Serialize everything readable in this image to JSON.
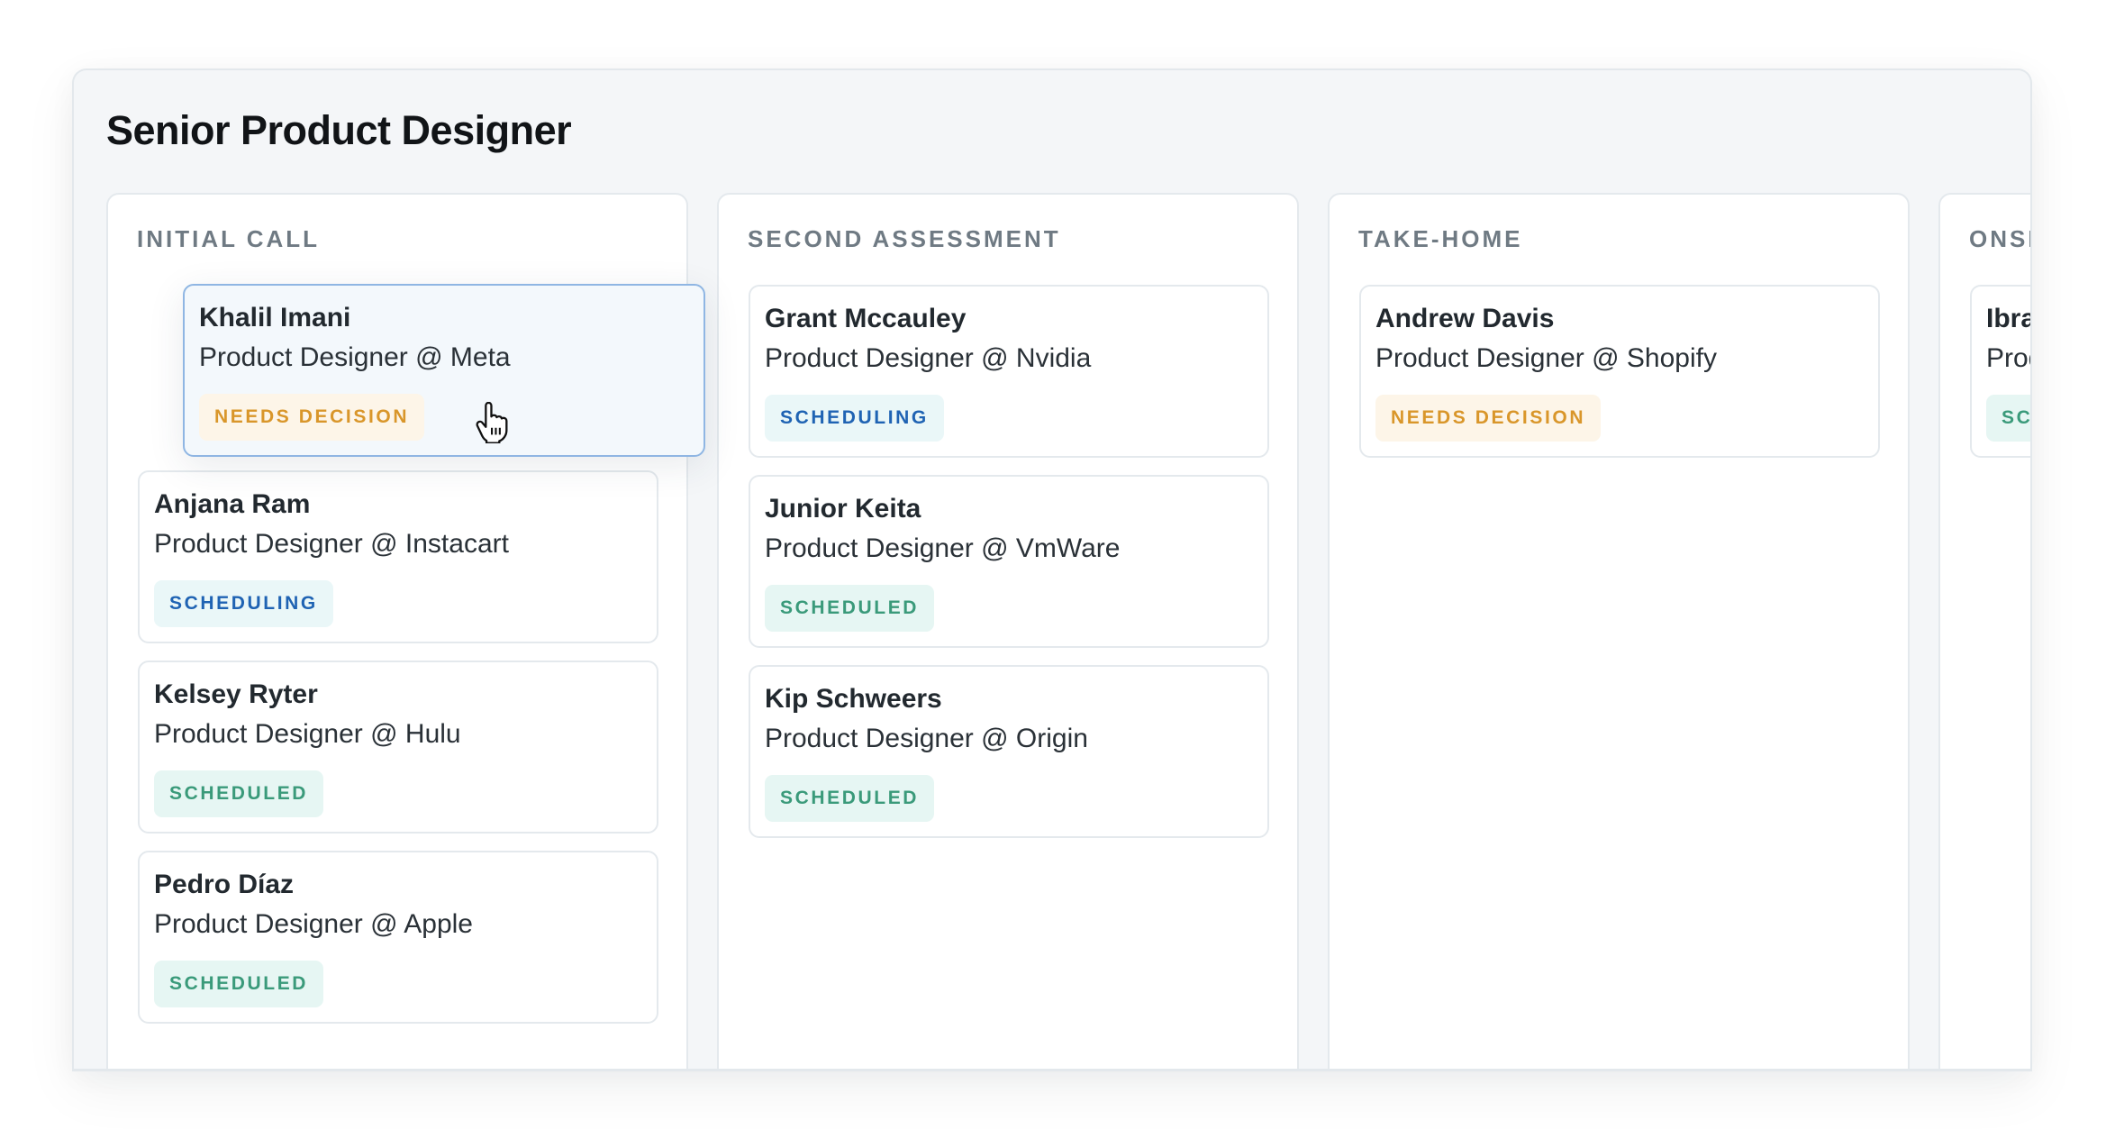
{
  "page": {
    "title": "Senior Product Designer"
  },
  "status_colors": {
    "needs_decision": {
      "bg": "#fdf5e8",
      "fg": "#d9962a"
    },
    "scheduling": {
      "bg": "#eaf7f8",
      "fg": "#1f63b3"
    },
    "scheduled": {
      "bg": "#e6f6f3",
      "fg": "#3a9a7a"
    }
  },
  "dragging_card": {
    "name": "Khalil Imani",
    "role": "Product Designer @ Meta",
    "status": "NEEDS DECISION",
    "status_key": "needs-decision"
  },
  "columns": [
    {
      "title": "INITIAL CALL",
      "cards": [
        {
          "name": "Anjana Ram",
          "role": "Product Designer @ Instacart",
          "status": "SCHEDULING",
          "status_key": "scheduling"
        },
        {
          "name": "Kelsey Ryter",
          "role": "Product Designer @ Hulu",
          "status": "SCHEDULED",
          "status_key": "scheduled"
        },
        {
          "name": "Pedro Díaz",
          "role": "Product Designer @ Apple",
          "status": "SCHEDULED",
          "status_key": "scheduled"
        }
      ]
    },
    {
      "title": "SECOND ASSESSMENT",
      "cards": [
        {
          "name": "Grant Mccauley",
          "role": "Product Designer @ Nvidia",
          "status": "SCHEDULING",
          "status_key": "scheduling"
        },
        {
          "name": "Junior Keita",
          "role": "Product Designer @ VmWare",
          "status": "SCHEDULED",
          "status_key": "scheduled"
        },
        {
          "name": "Kip Schweers",
          "role": "Product Designer @ Origin",
          "status": "SCHEDULED",
          "status_key": "scheduled"
        }
      ]
    },
    {
      "title": "TAKE-HOME",
      "cards": [
        {
          "name": "Andrew Davis",
          "role": "Product Designer @ Shopify",
          "status": "NEEDS DECISION",
          "status_key": "needs-decision"
        }
      ]
    },
    {
      "title": "ONSITE",
      "cards": [
        {
          "name": "Ibra",
          "role": "Prod",
          "status": "SCH",
          "status_key": "scheduled"
        }
      ]
    }
  ],
  "icons": {
    "cursor": "hand-grab-cursor-icon"
  }
}
